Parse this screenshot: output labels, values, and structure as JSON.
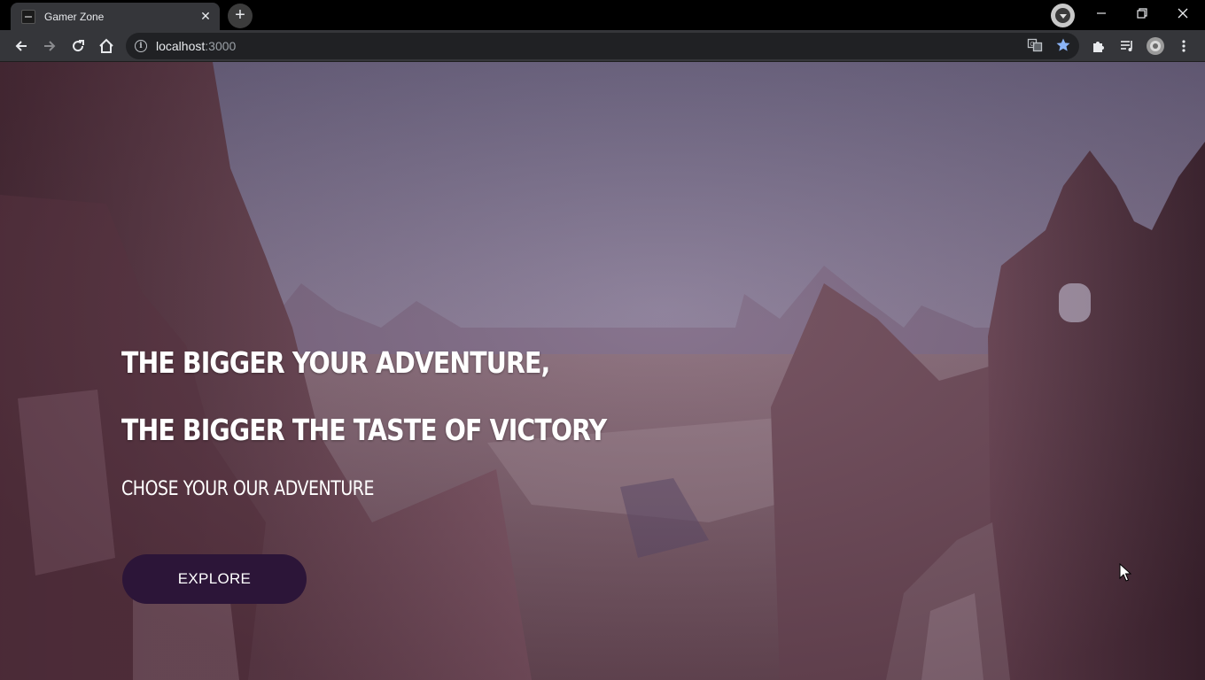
{
  "browser": {
    "tab": {
      "title": "Gamer Zone",
      "close_glyph": "✕"
    },
    "new_tab_glyph": "+",
    "window_controls": {
      "minimize": "—",
      "restore": "❐",
      "close": "✕"
    },
    "address": {
      "host": "localhost",
      "port": ":3000"
    },
    "icons": [
      "back-icon",
      "forward-icon",
      "reload-icon",
      "home-icon",
      "info-icon",
      "translate-icon",
      "star-icon",
      "extensions-icon",
      "media-control-icon",
      "profile-avatar-icon",
      "kebab-menu-icon"
    ],
    "colors": {
      "star": "#8ab4f8",
      "chrome_bg": "#35363a",
      "tabstrip_bg": "#000000",
      "omnibox_bg": "#202124"
    }
  },
  "hero": {
    "heading_line1": "THE BIGGER YOUR ADVENTURE,",
    "heading_line2": "THE BIGGER THE TASTE OF VICTORY",
    "subheading": "CHOSE YOUR OUR ADVENTURE",
    "cta_label": "EXPLORE",
    "colors": {
      "cta_bg": "#2c1538",
      "text": "#ffffff"
    }
  }
}
